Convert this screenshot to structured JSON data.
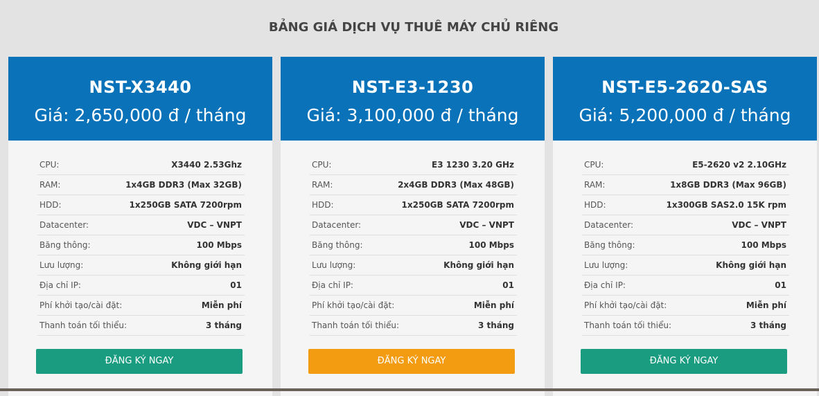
{
  "page": {
    "title": "BẢNG GIÁ DỊCH VỤ THUÊ MÁY CHỦ RIÊNG"
  },
  "colors": {
    "header_blue": "#0a72b9",
    "button_green": "#1a9c81",
    "button_orange": "#f39c12",
    "page_background": "#e3e3e3",
    "card_background": "#f5f5f5"
  },
  "plans": [
    {
      "name": "NST-X3440",
      "price": "Giá: 2,650,000 đ / tháng",
      "specs": [
        {
          "label": "CPU:",
          "value": "X3440 2.53Ghz"
        },
        {
          "label": "RAM:",
          "value": "1x4GB DDR3 (Max 32GB)"
        },
        {
          "label": "HDD:",
          "value": "1x250GB SATA 7200rpm"
        },
        {
          "label": "Datacenter:",
          "value": "VDC – VNPT"
        },
        {
          "label": "Băng thông:",
          "value": "100 Mbps"
        },
        {
          "label": "Lưu lượng:",
          "value": "Không giới hạn"
        },
        {
          "label": "Địa chỉ IP:",
          "value": "01"
        },
        {
          "label": "Phí khởi tạo/cài đặt:",
          "value": "Miễn phí"
        },
        {
          "label": "Thanh toán tối thiểu:",
          "value": "3 tháng"
        }
      ],
      "button_label": "ĐĂNG KÝ NGAY",
      "button_color": "green"
    },
    {
      "name": "NST-E3-1230",
      "price": "Giá: 3,100,000 đ / tháng",
      "specs": [
        {
          "label": "CPU:",
          "value": "E3 1230 3.20 GHz"
        },
        {
          "label": "RAM:",
          "value": "2x4GB DDR3 (Max 48GB)"
        },
        {
          "label": "HDD:",
          "value": "1x250GB SATA 7200rpm"
        },
        {
          "label": "Datacenter:",
          "value": "VDC – VNPT"
        },
        {
          "label": "Băng thông:",
          "value": "100 Mbps"
        },
        {
          "label": "Lưu lượng:",
          "value": "Không giới hạn"
        },
        {
          "label": "Địa chỉ IP:",
          "value": "01"
        },
        {
          "label": "Phí khởi tạo/cài đặt:",
          "value": "Miễn phí"
        },
        {
          "label": "Thanh toán tối thiểu:",
          "value": "3 tháng"
        }
      ],
      "button_label": "ĐĂNG KÝ NGAY",
      "button_color": "orange"
    },
    {
      "name": "NST-E5-2620-SAS",
      "price": "Giá: 5,200,000 đ / tháng",
      "specs": [
        {
          "label": "CPU:",
          "value": "E5-2620 v2 2.10GHz"
        },
        {
          "label": "RAM:",
          "value": "1x8GB DDR3 (Max 96GB)"
        },
        {
          "label": "HDD:",
          "value": "1x300GB SAS2.0 15K rpm"
        },
        {
          "label": "Datacenter:",
          "value": "VDC – VNPT"
        },
        {
          "label": "Băng thông:",
          "value": "100 Mbps"
        },
        {
          "label": "Lưu lượng:",
          "value": "Không giới hạn"
        },
        {
          "label": "Địa chỉ IP:",
          "value": "01"
        },
        {
          "label": "Phí khởi tạo/cài đặt:",
          "value": "Miễn phí"
        },
        {
          "label": "Thanh toán tối thiểu:",
          "value": "3 tháng"
        }
      ],
      "button_label": "ĐĂNG KÝ NGAY",
      "button_color": "green"
    }
  ]
}
